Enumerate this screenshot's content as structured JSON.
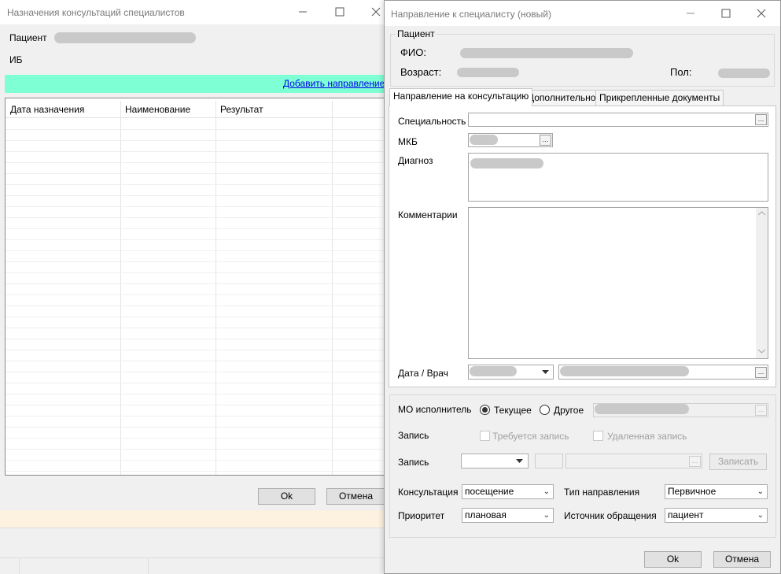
{
  "bg_window": {
    "title": "Назначения консультаций специалистов",
    "patient_label": "Пациент",
    "ib_label": "ИБ",
    "add_link": "Добавить направление",
    "columns": [
      "Дата назначения",
      "Наименование",
      "Результат"
    ],
    "ok": "Ok",
    "cancel": "Отмена"
  },
  "dialog": {
    "title": "Направление к специалисту (новый)",
    "patient_group": "Пациент",
    "fio_label": "ФИО:",
    "age_label": "Возраст:",
    "sex_label": "Пол:",
    "tabs": [
      "Направление на консультацию",
      "Дополнительно",
      "Прикрепленные документы"
    ],
    "specialty_label": "Специальность",
    "mkb_label": "МКБ",
    "diagnosis_label": "Диагноз",
    "comments_label": "Комментарии",
    "date_doctor_label": "Дата / Врач",
    "mo_label": "МО исполнитель",
    "radio_current": "Текущее",
    "radio_other": "Другое",
    "record_label": "Запись",
    "requires_record": "Требуется запись",
    "remote_record": "Удаленная запись",
    "record_label2": "Запись",
    "record_button": "Записать",
    "consult_label": "Консультация",
    "consult_value": "посещение",
    "direction_type_label": "Тип направления",
    "direction_type_value": "Первичное",
    "priority_label": "Приоритет",
    "priority_value": "плановая",
    "source_label": "Источник обращения",
    "source_value": "пациент",
    "ok": "Ok",
    "cancel": "Отмена"
  },
  "colors": {
    "teal_bar": "#7fffd4",
    "link": "#0000ee",
    "orange_strip": "#fdf1e0"
  },
  "icons": [
    "minimize-icon",
    "maximize-icon",
    "close-icon",
    "ellipsis-icon",
    "chevron-down-icon",
    "scroll-up-icon",
    "scroll-down-icon"
  ]
}
